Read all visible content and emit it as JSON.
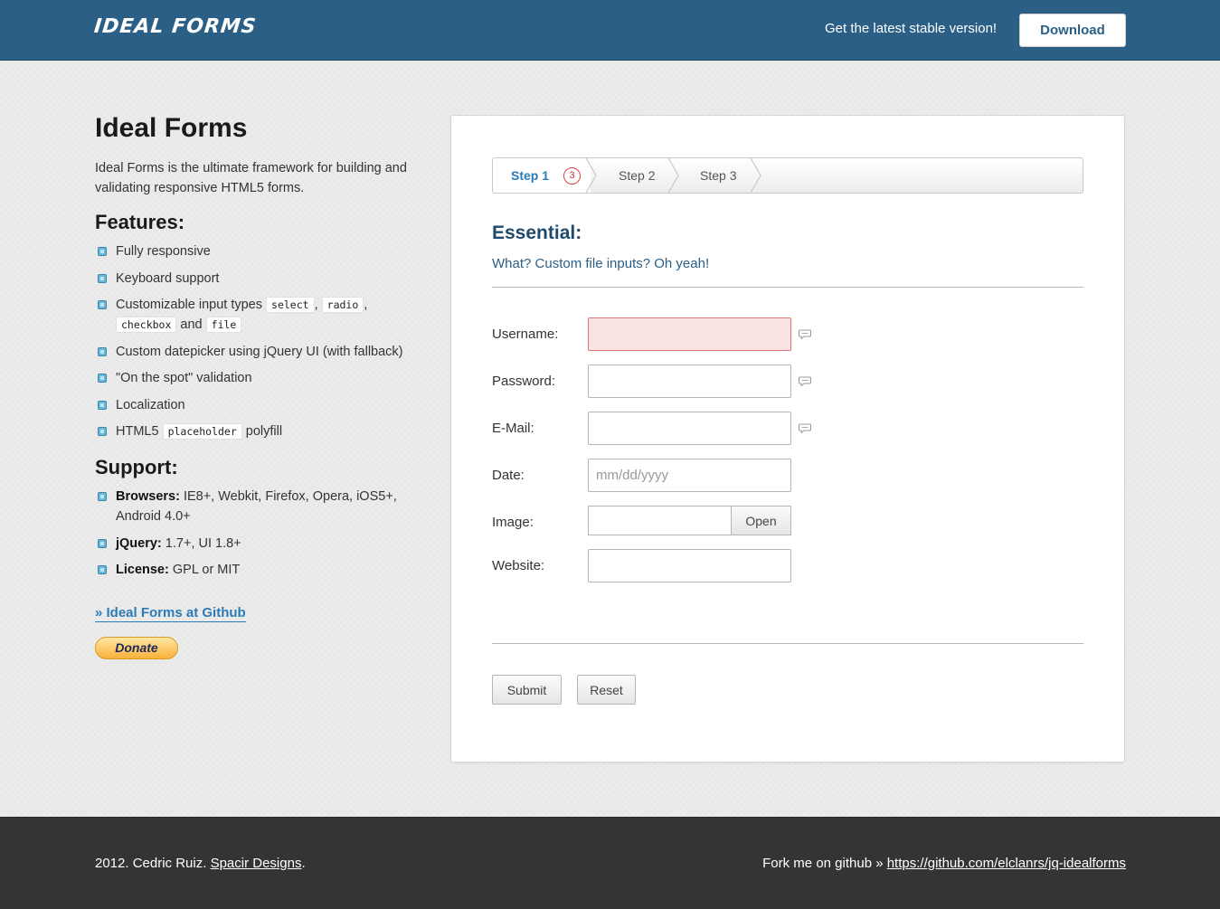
{
  "header": {
    "logo": "IDEAL FORMS",
    "tagline": "Get the latest stable version!",
    "download_label": "Download"
  },
  "sidebar": {
    "title": "Ideal Forms",
    "intro": "Ideal Forms is the ultimate framework for building and validating responsive HTML5 forms.",
    "features_title": "Features:",
    "features": {
      "f1": "Fully responsive",
      "f2": "Keyboard support",
      "f3_prefix": "Customizable input types",
      "f3_code1": "select",
      "f3_code2": "radio",
      "f3_code3": "checkbox",
      "f3_and": "and",
      "f3_code4": "file",
      "f4": "Custom datepicker using jQuery UI (with fallback)",
      "f5": "\"On the spot\" validation",
      "f6": "Localization",
      "f7_prefix": "HTML5",
      "f7_code": "placeholder",
      "f7_suffix": "polyfill"
    },
    "support_title": "Support:",
    "support": {
      "browsers_label": "Browsers:",
      "browsers_value": " IE8+, Webkit, Firefox, Opera, iOS5+, Android 4.0+",
      "jquery_label": "jQuery:",
      "jquery_value": " 1.7+, UI 1.8+",
      "license_label": "License:",
      "license_value": " GPL or MIT"
    },
    "github_link": "» Ideal Forms at Github",
    "donate_label": "Donate"
  },
  "form": {
    "steps": {
      "step1": "Step 1",
      "step1_badge": "3",
      "step2": "Step 2",
      "step3": "Step 3"
    },
    "section_title": "Essential:",
    "section_subtitle": "What? Custom file inputs? Oh yeah!",
    "fields": {
      "username_label": "Username:",
      "password_label": "Password:",
      "email_label": "E-Mail:",
      "date_label": "Date:",
      "date_placeholder": "mm/dd/yyyy",
      "image_label": "Image:",
      "image_button": "Open",
      "website_label": "Website:"
    },
    "submit_label": "Submit",
    "reset_label": "Reset"
  },
  "footer": {
    "copyright": "2012. Cedric Ruiz. ",
    "company_link": "Spacir Designs",
    "period": ".",
    "fork_text": "Fork me on github » ",
    "github_url": "https://github.com/elclanrs/jq-idealforms"
  },
  "colors": {
    "header_bg": "#2b5f86",
    "accent": "#2b7bb6",
    "footer_bg": "#343434",
    "error_bg": "#fbe3e3"
  }
}
